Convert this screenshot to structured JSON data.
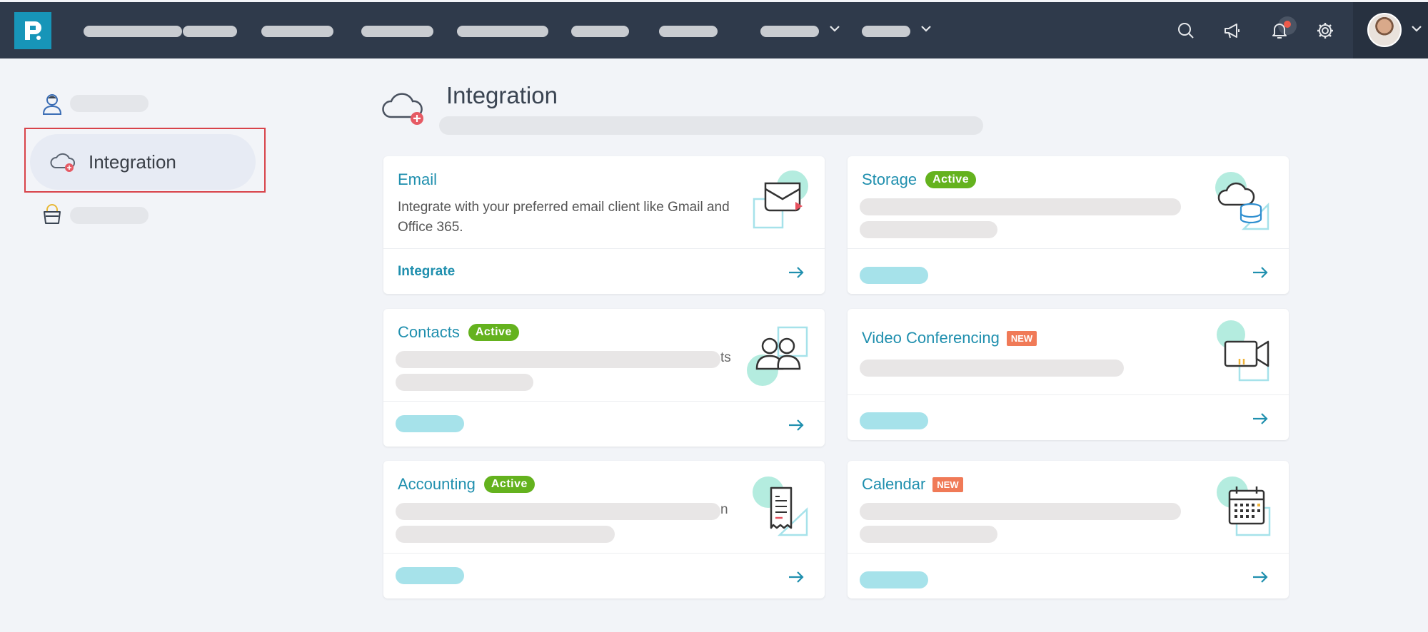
{
  "header": {
    "title": "Integration"
  },
  "sidebar": {
    "active_item": "Integration"
  },
  "cards": [
    {
      "title": "Email",
      "badge": "",
      "description": "Integrate with your preferred email client like Gmail and Office 365.",
      "link": "Integrate",
      "icon": "email-icon"
    },
    {
      "title": "Storage",
      "badge": "Active",
      "icon": "cloud-storage-icon"
    },
    {
      "title": "Contacts",
      "badge": "Active",
      "fragment": "ts",
      "icon": "contacts-icon"
    },
    {
      "title": "Video Conferencing",
      "badge": "NEW",
      "icon": "video-camera-icon"
    },
    {
      "title": "Accounting",
      "badge": "Active",
      "fragment": "n",
      "icon": "invoice-icon"
    },
    {
      "title": "Calendar",
      "badge": "NEW",
      "icon": "calendar-icon"
    }
  ],
  "colors": {
    "nav_bg": "#2f3a4b",
    "accent": "#1f8fae",
    "active_badge": "#64b21e",
    "new_badge": "#f07a57",
    "highlight_outline": "#d8434a"
  }
}
